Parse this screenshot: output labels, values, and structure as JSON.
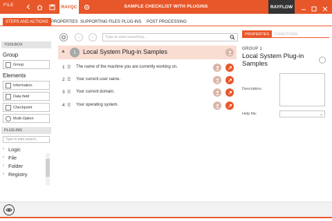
{
  "titlebar": {
    "file_label": "FILE",
    "app_tab": "RAYQC",
    "title": "SAMPLE CHECKLIST WITH PLUGINS",
    "brand": "RAYFLOW",
    "icons": [
      "back-icon",
      "home-icon",
      "save-icon",
      "gear-icon",
      "minimize-icon",
      "maximize-icon",
      "close-icon"
    ]
  },
  "tabs": [
    {
      "label": "STEPS AND ACTIONS",
      "active": true
    },
    {
      "label": "PROPERTIES",
      "active": false
    },
    {
      "label": "SUPPORTING FILES",
      "active": false
    },
    {
      "label": "PLUG-INS",
      "active": false
    },
    {
      "label": "POST PROCESSING",
      "active": false
    }
  ],
  "toolbox": {
    "header": "TOOLBOX",
    "group_title": "Group",
    "group_button": "Group",
    "elements_title": "Elements",
    "elements": [
      "Information",
      "Data field",
      "Checkpoint",
      "Multi-Option"
    ]
  },
  "plugins": {
    "header": "PLUG-INS",
    "search_placeholder": "Type to start search...",
    "tree": [
      "Logic",
      "File",
      "Folder",
      "Registry"
    ]
  },
  "main": {
    "search_placeholder": "Type to start searching...",
    "group": {
      "number": "1",
      "title": "Local System Plug-in Samples"
    },
    "steps": [
      {
        "n": "1",
        "text": "The name of the machine you are currently working on."
      },
      {
        "n": "2",
        "text": "Your current user name."
      },
      {
        "n": "3",
        "text": "Your current domain."
      },
      {
        "n": "4",
        "text": "Your operating system."
      }
    ]
  },
  "properties": {
    "tab_properties": "PROPERTIES",
    "tab_conditions": "CONDITIONS",
    "group_label": "GROUP 1",
    "title": "Local System Plug-in Samples",
    "description_label": "Description:",
    "description_value": "",
    "helpfile_label": "Help file:",
    "helpfile_value": ""
  },
  "colors": {
    "accent": "#e8572a",
    "group_bg": "#f9ddd2",
    "dark": "#333333"
  }
}
